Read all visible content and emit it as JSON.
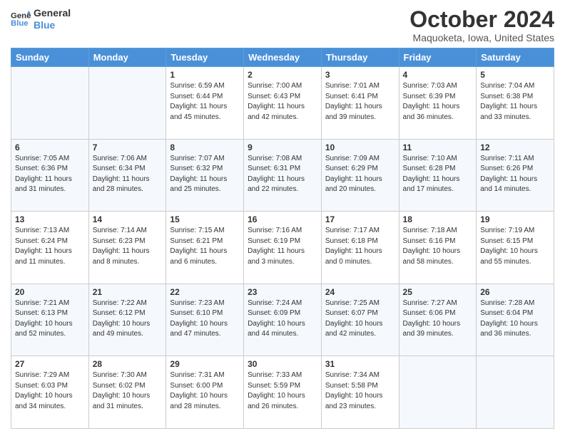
{
  "header": {
    "logo_line1": "General",
    "logo_line2": "Blue",
    "month": "October 2024",
    "location": "Maquoketa, Iowa, United States"
  },
  "weekdays": [
    "Sunday",
    "Monday",
    "Tuesday",
    "Wednesday",
    "Thursday",
    "Friday",
    "Saturday"
  ],
  "weeks": [
    [
      {
        "day": "",
        "info": ""
      },
      {
        "day": "",
        "info": ""
      },
      {
        "day": "1",
        "info": "Sunrise: 6:59 AM\nSunset: 6:44 PM\nDaylight: 11 hours and 45 minutes."
      },
      {
        "day": "2",
        "info": "Sunrise: 7:00 AM\nSunset: 6:43 PM\nDaylight: 11 hours and 42 minutes."
      },
      {
        "day": "3",
        "info": "Sunrise: 7:01 AM\nSunset: 6:41 PM\nDaylight: 11 hours and 39 minutes."
      },
      {
        "day": "4",
        "info": "Sunrise: 7:03 AM\nSunset: 6:39 PM\nDaylight: 11 hours and 36 minutes."
      },
      {
        "day": "5",
        "info": "Sunrise: 7:04 AM\nSunset: 6:38 PM\nDaylight: 11 hours and 33 minutes."
      }
    ],
    [
      {
        "day": "6",
        "info": "Sunrise: 7:05 AM\nSunset: 6:36 PM\nDaylight: 11 hours and 31 minutes."
      },
      {
        "day": "7",
        "info": "Sunrise: 7:06 AM\nSunset: 6:34 PM\nDaylight: 11 hours and 28 minutes."
      },
      {
        "day": "8",
        "info": "Sunrise: 7:07 AM\nSunset: 6:32 PM\nDaylight: 11 hours and 25 minutes."
      },
      {
        "day": "9",
        "info": "Sunrise: 7:08 AM\nSunset: 6:31 PM\nDaylight: 11 hours and 22 minutes."
      },
      {
        "day": "10",
        "info": "Sunrise: 7:09 AM\nSunset: 6:29 PM\nDaylight: 11 hours and 20 minutes."
      },
      {
        "day": "11",
        "info": "Sunrise: 7:10 AM\nSunset: 6:28 PM\nDaylight: 11 hours and 17 minutes."
      },
      {
        "day": "12",
        "info": "Sunrise: 7:11 AM\nSunset: 6:26 PM\nDaylight: 11 hours and 14 minutes."
      }
    ],
    [
      {
        "day": "13",
        "info": "Sunrise: 7:13 AM\nSunset: 6:24 PM\nDaylight: 11 hours and 11 minutes."
      },
      {
        "day": "14",
        "info": "Sunrise: 7:14 AM\nSunset: 6:23 PM\nDaylight: 11 hours and 8 minutes."
      },
      {
        "day": "15",
        "info": "Sunrise: 7:15 AM\nSunset: 6:21 PM\nDaylight: 11 hours and 6 minutes."
      },
      {
        "day": "16",
        "info": "Sunrise: 7:16 AM\nSunset: 6:19 PM\nDaylight: 11 hours and 3 minutes."
      },
      {
        "day": "17",
        "info": "Sunrise: 7:17 AM\nSunset: 6:18 PM\nDaylight: 11 hours and 0 minutes."
      },
      {
        "day": "18",
        "info": "Sunrise: 7:18 AM\nSunset: 6:16 PM\nDaylight: 10 hours and 58 minutes."
      },
      {
        "day": "19",
        "info": "Sunrise: 7:19 AM\nSunset: 6:15 PM\nDaylight: 10 hours and 55 minutes."
      }
    ],
    [
      {
        "day": "20",
        "info": "Sunrise: 7:21 AM\nSunset: 6:13 PM\nDaylight: 10 hours and 52 minutes."
      },
      {
        "day": "21",
        "info": "Sunrise: 7:22 AM\nSunset: 6:12 PM\nDaylight: 10 hours and 49 minutes."
      },
      {
        "day": "22",
        "info": "Sunrise: 7:23 AM\nSunset: 6:10 PM\nDaylight: 10 hours and 47 minutes."
      },
      {
        "day": "23",
        "info": "Sunrise: 7:24 AM\nSunset: 6:09 PM\nDaylight: 10 hours and 44 minutes."
      },
      {
        "day": "24",
        "info": "Sunrise: 7:25 AM\nSunset: 6:07 PM\nDaylight: 10 hours and 42 minutes."
      },
      {
        "day": "25",
        "info": "Sunrise: 7:27 AM\nSunset: 6:06 PM\nDaylight: 10 hours and 39 minutes."
      },
      {
        "day": "26",
        "info": "Sunrise: 7:28 AM\nSunset: 6:04 PM\nDaylight: 10 hours and 36 minutes."
      }
    ],
    [
      {
        "day": "27",
        "info": "Sunrise: 7:29 AM\nSunset: 6:03 PM\nDaylight: 10 hours and 34 minutes."
      },
      {
        "day": "28",
        "info": "Sunrise: 7:30 AM\nSunset: 6:02 PM\nDaylight: 10 hours and 31 minutes."
      },
      {
        "day": "29",
        "info": "Sunrise: 7:31 AM\nSunset: 6:00 PM\nDaylight: 10 hours and 28 minutes."
      },
      {
        "day": "30",
        "info": "Sunrise: 7:33 AM\nSunset: 5:59 PM\nDaylight: 10 hours and 26 minutes."
      },
      {
        "day": "31",
        "info": "Sunrise: 7:34 AM\nSunset: 5:58 PM\nDaylight: 10 hours and 23 minutes."
      },
      {
        "day": "",
        "info": ""
      },
      {
        "day": "",
        "info": ""
      }
    ]
  ]
}
